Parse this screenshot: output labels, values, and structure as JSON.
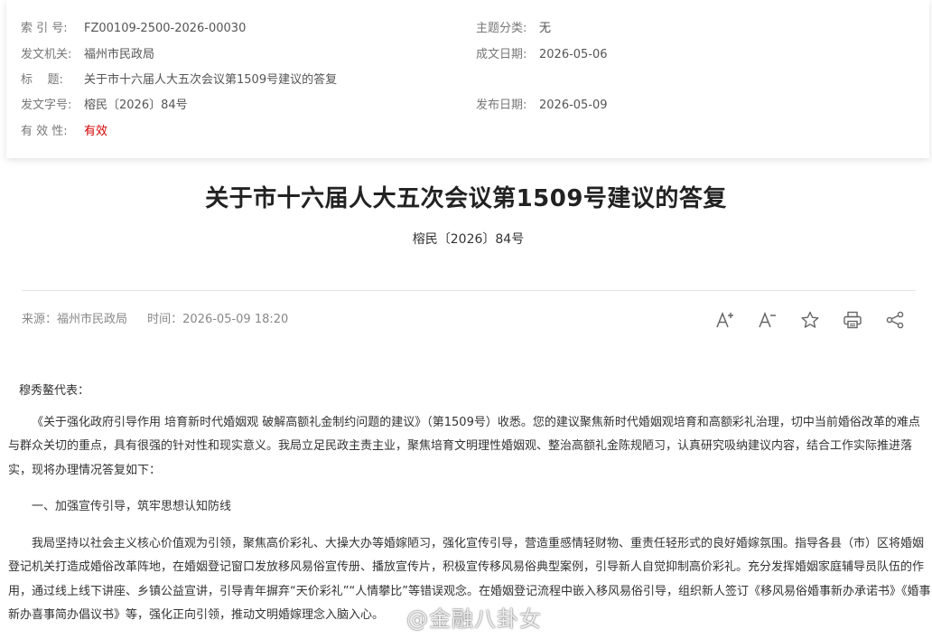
{
  "meta": {
    "index_label": "索 引 号:",
    "index_value": "FZ00109-2500-2026-00030",
    "category_label": "主题分类:",
    "category_value": "无",
    "issuer_label": "发文机关:",
    "issuer_value": "福州市民政局",
    "date_label": "成文日期:",
    "date_value": "2026-05-06",
    "title_label": "标    题:",
    "title_value": "关于市十六届人大五次会议第1509号建议的答复",
    "docno_label": "发文字号:",
    "docno_value": "榕民〔2026〕84号",
    "publish_label": "发布日期:",
    "publish_value": "2026-05-09",
    "validity_label": "有 效 性:",
    "validity_value": "有效"
  },
  "document": {
    "title": "关于市十六届人大五次会议第1509号建议的答复",
    "number": "榕民〔2026〕84号",
    "source": "来源：福州市民政局",
    "time": "时间：2026-05-09 18:20"
  },
  "toolbar": {
    "icons": [
      "font-increase-icon",
      "font-decrease-icon",
      "star-icon",
      "print-icon",
      "share-icon"
    ],
    "increase_label": "A",
    "decrease_label": "A"
  },
  "article": {
    "salutation": "穆秀鳌代表：",
    "p1": "《关于强化政府引导作用 培育新时代婚姻观 破解高额礼金制约问题的建议》（第1509号）收悉。您的建议聚焦新时代婚姻观培育和高额彩礼治理，切中当前婚俗改革的难点与群众关切的重点，具有很强的针对性和现实意义。我局立足民政主责主业，聚焦培育文明理性婚姻观、整治高额礼金陈规陋习，认真研究吸纳建议内容，结合工作实际推进落实，现将办理情况答复如下：",
    "h1": "一、加强宣传引导，筑牢思想认知防线",
    "p2": "我局坚持以社会主义核心价值观为引领，聚焦高价彩礼、大操大办等婚嫁陋习，强化宣传引导，营造重感情轻财物、重责任轻形式的良好婚嫁氛围。指导各县（市）区将婚姻登记机关打造成婚俗改革阵地，在婚姻登记窗口发放移风易俗宣传册、播放宣传片，积极宣传移风易俗典型案例，引导新人自觉抑制高价彩礼。充分发挥婚姻家庭辅导员队伍的作用，通过线上线下讲座、乡镇公益宣讲，引导青年摒弃“天价彩礼”“人情攀比”等错误观念。在婚姻登记流程中嵌入移风易俗引导，组织新人签订《移风易俗婚事新办承诺书》《婚事新办喜事简办倡议书》等，强化正向引领，推动文明婚嫁理念入脑入心。"
  },
  "watermark": {
    "text": "@金融八卦女"
  }
}
